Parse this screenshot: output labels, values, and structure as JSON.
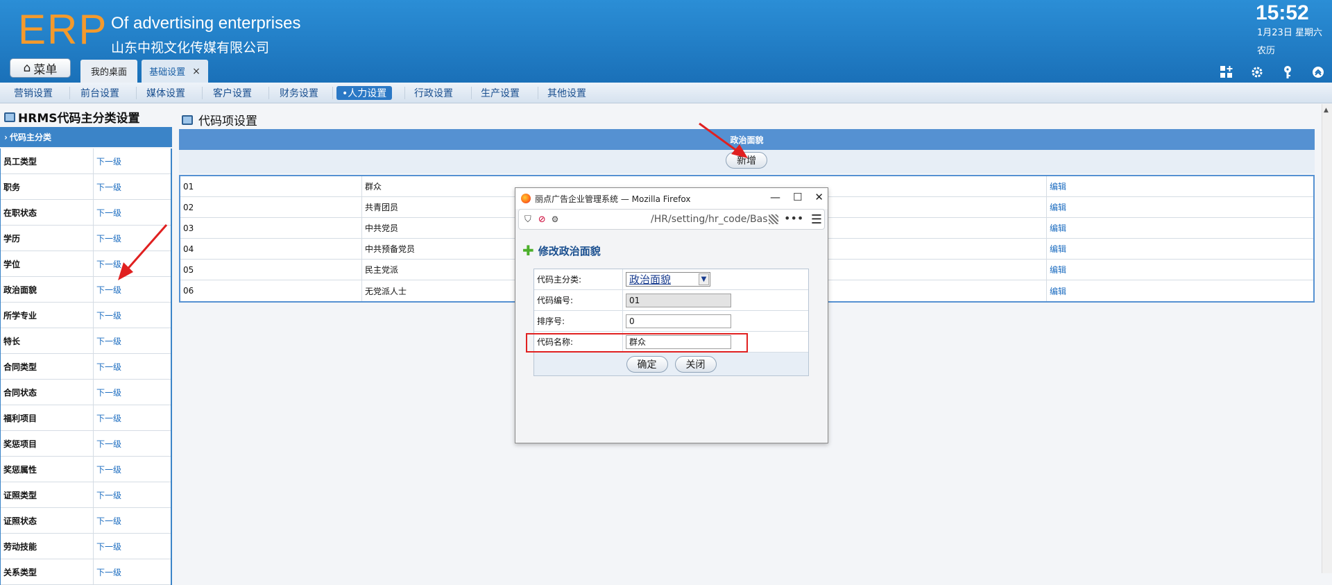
{
  "header": {
    "logo": "ERP",
    "subtitle_en": "Of advertising enterprises",
    "subtitle_cn": "山东中视文化传媒有限公司",
    "time": "15:52",
    "date": "1月23日 星期六",
    "lunar": "农历",
    "menu_label": "菜单",
    "tabs": [
      {
        "label": "我的桌面"
      },
      {
        "label": "基础设置",
        "close": "×"
      }
    ]
  },
  "nav": {
    "items": [
      "营销设置",
      "前台设置",
      "媒体设置",
      "客户设置",
      "财务设置",
      "•人力设置",
      "行政设置",
      "生产设置",
      "其他设置"
    ],
    "active_index": 5
  },
  "left": {
    "title": "HRMS代码主分类设置",
    "header": "代码主分类",
    "link_text": "下一级",
    "items": [
      "员工类型",
      "职务",
      "在职状态",
      "学历",
      "学位",
      "政治面貌",
      "所学专业",
      "特长",
      "合同类型",
      "合同状态",
      "福利项目",
      "奖惩项目",
      "奖惩属性",
      "证照类型",
      "证照状态",
      "劳动技能",
      "关系类型"
    ]
  },
  "right": {
    "title": "代码项设置",
    "grid_title": "政治面貌",
    "add_label": "新增",
    "edit_label": "编辑",
    "rows": [
      {
        "code": "01",
        "name": "群众"
      },
      {
        "code": "02",
        "name": "共青团员"
      },
      {
        "code": "03",
        "name": "中共党员"
      },
      {
        "code": "04",
        "name": "中共预备党员"
      },
      {
        "code": "05",
        "name": "民主党派"
      },
      {
        "code": "06",
        "name": "无党派人士"
      }
    ]
  },
  "popup": {
    "window_title": "丽点广告企业管理系统 — Mozilla Firefox",
    "url": "/HR/setting/hr_code/Bas",
    "form_title": "修改政治面貌",
    "fields": {
      "category_label": "代码主分类:",
      "category_value": "政治面貌",
      "code_label": "代码编号:",
      "code_value": "01",
      "order_label": "排序号:",
      "order_value": "0",
      "name_label": "代码名称:",
      "name_value": "群众"
    },
    "ok_label": "确定",
    "close_label": "关闭"
  },
  "colors": {
    "header_blue": "#1a70b8",
    "logo_orange": "#f49a2c",
    "grid_blue": "#5591d2",
    "highlight_red": "#e02020"
  }
}
